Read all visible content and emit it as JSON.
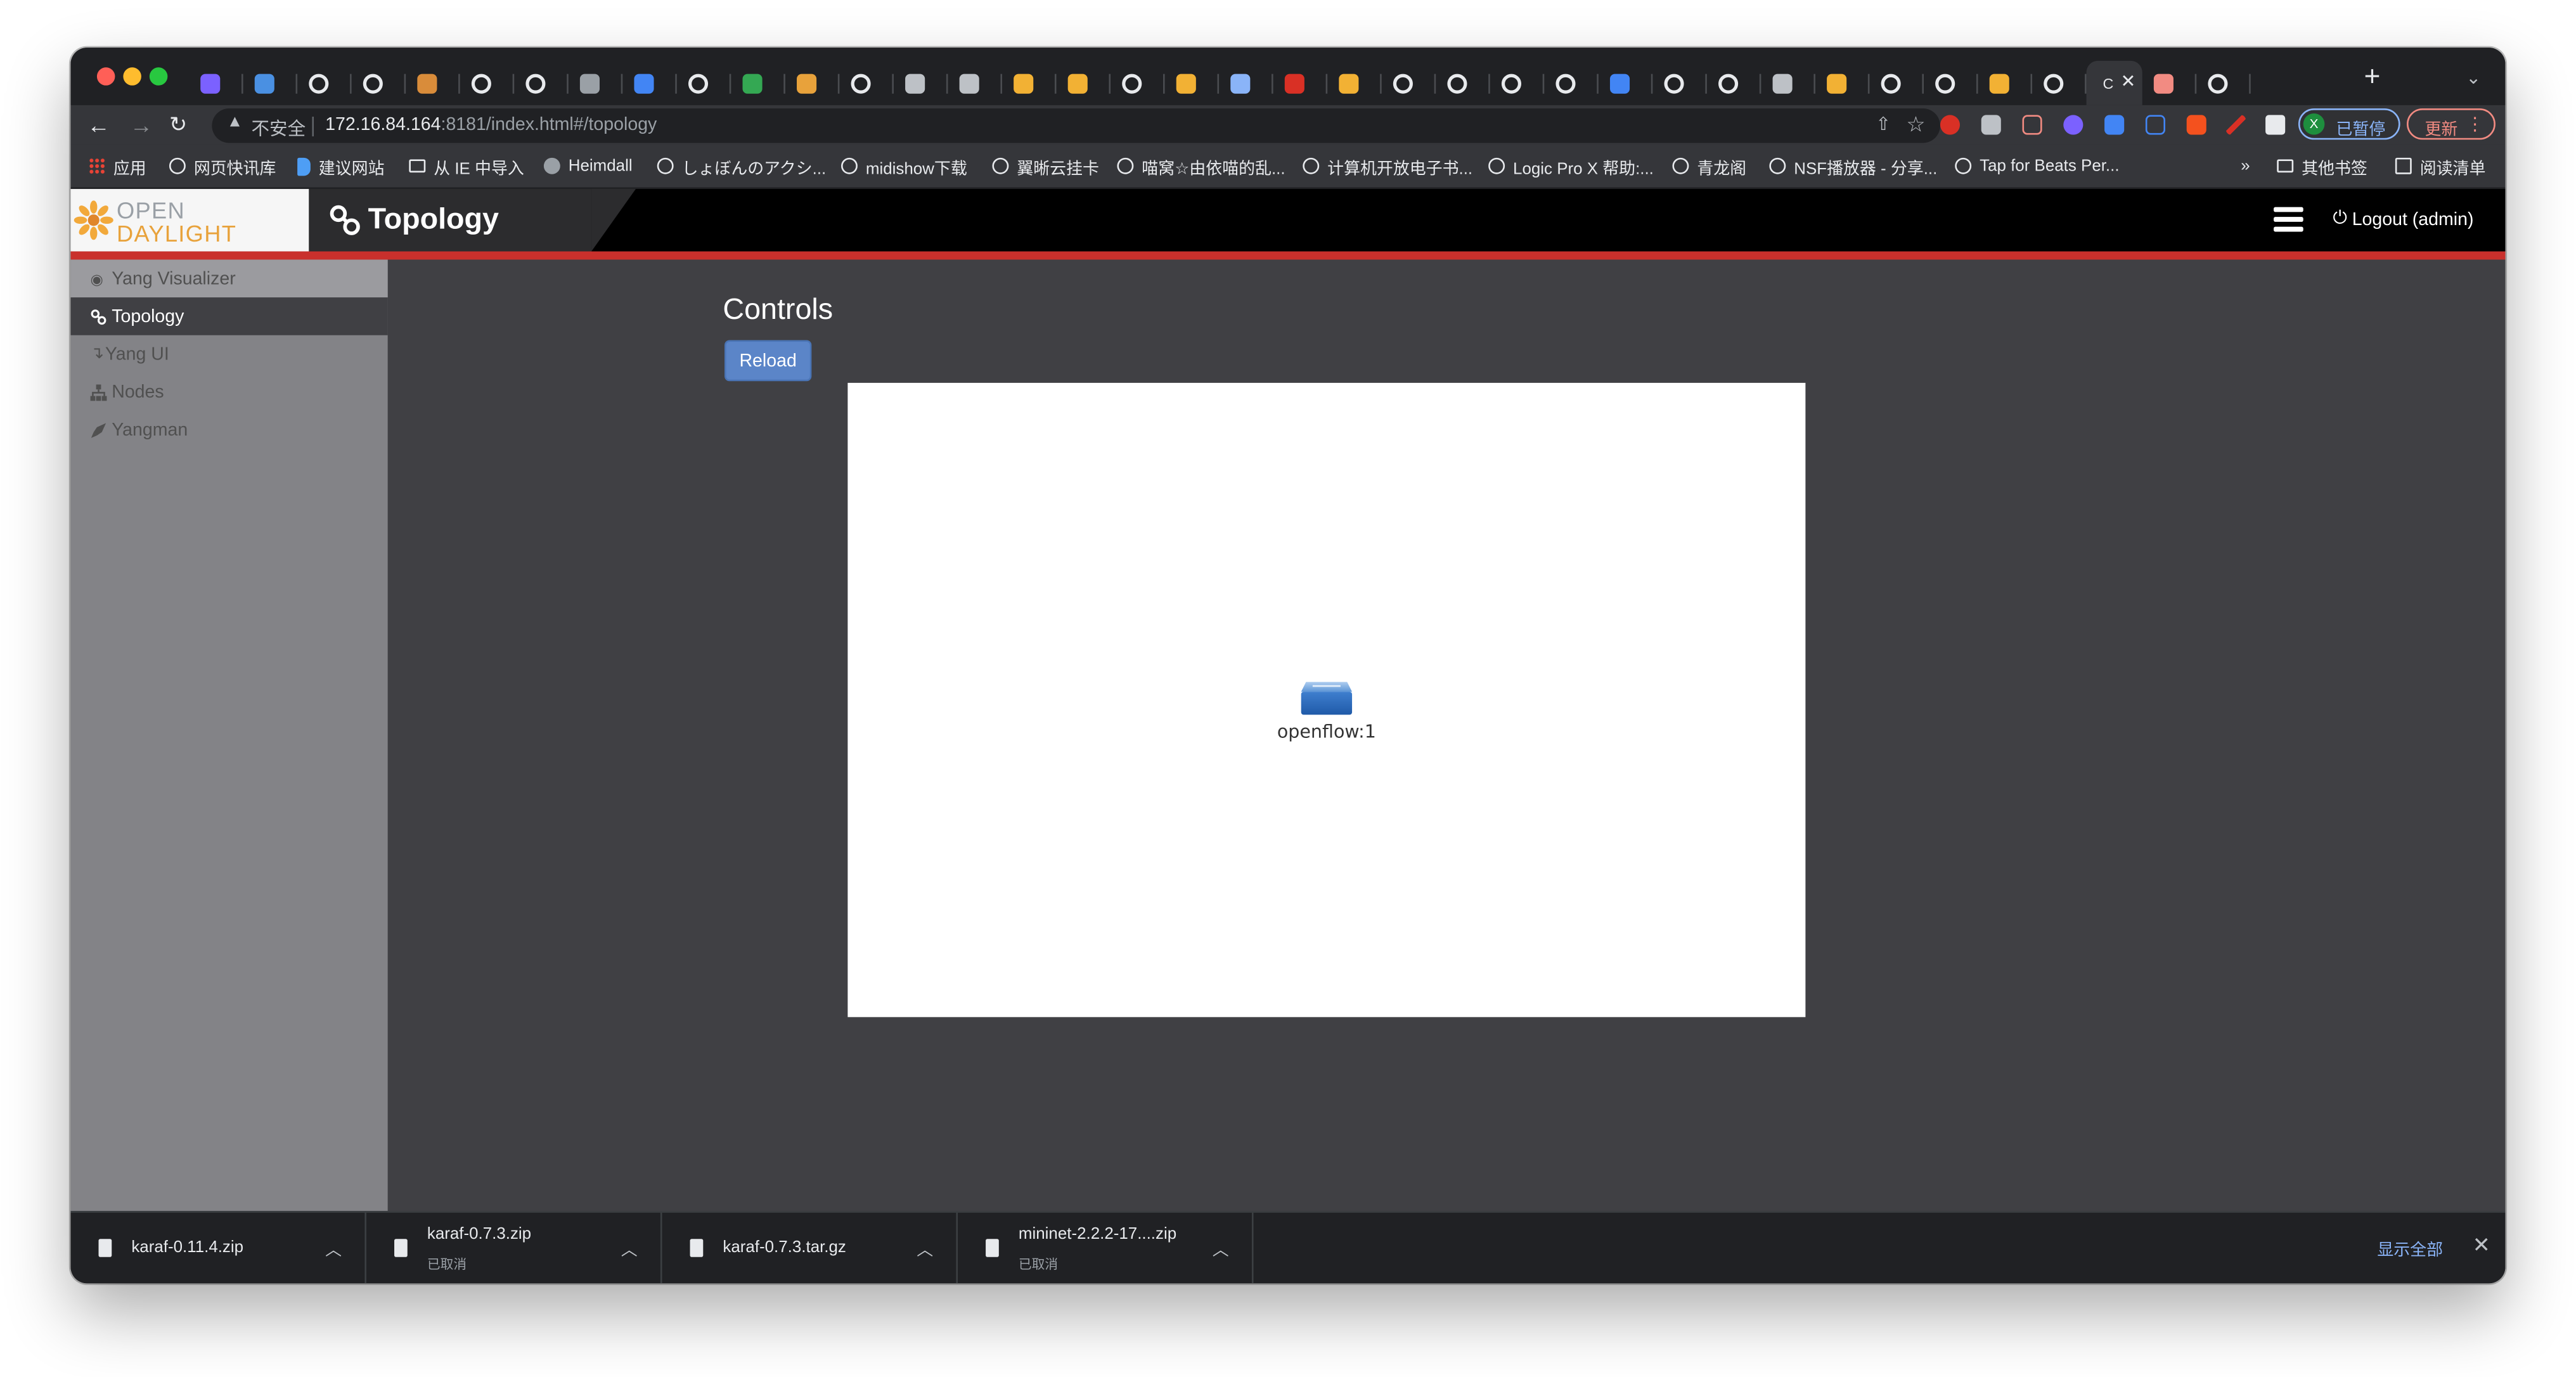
{
  "browser": {
    "active_tab_title": "C",
    "url_warning": "不安全",
    "url_host": "172.16.84.164",
    "url_rest": ":8181/index.html#/topology",
    "profile_label": "已暂停",
    "profile_initial": "X",
    "update_label": "更新",
    "new_tab_glyph": "+",
    "bookmarks": [
      "应用",
      "网页快讯库",
      "建议网站",
      "从 IE 中导入",
      "Heimdall",
      "しょぼんのアクシ...",
      "midishow下载",
      "翼晰云挂卡",
      "喵窝☆由依喵的乱...",
      "计算机开放电子书...",
      "Logic Pro X 帮助:...",
      "青龙阁",
      "NSF播放器 - 分享...",
      "Tap for Beats Per..."
    ],
    "bookmarks_overflow": "»",
    "other_bookmarks": "其他书签",
    "reading_list": "阅读清单"
  },
  "app": {
    "logo_line1": "OPEN",
    "logo_line2": "DAYLIGHT",
    "page_title": "Topology",
    "logout_label": "Logout (admin)",
    "sidebar": [
      {
        "label": "Yang Visualizer",
        "icon": "eye-icon"
      },
      {
        "label": "Topology",
        "icon": "link-icon"
      },
      {
        "label": "Yang UI",
        "icon": "level-down-icon"
      },
      {
        "label": "Nodes",
        "icon": "sitemap-icon"
      },
      {
        "label": "Yangman",
        "icon": "rocket-icon"
      }
    ],
    "controls_title": "Controls",
    "reload_label": "Reload",
    "node_label": "openflow:1"
  },
  "downloads": {
    "items": [
      {
        "name": "karaf-0.11.4.zip",
        "status": ""
      },
      {
        "name": "karaf-0.7.3.zip",
        "status": "已取消"
      },
      {
        "name": "karaf-0.7.3.tar.gz",
        "status": ""
      },
      {
        "name": "mininet-2.2.2-17....zip",
        "status": "已取消"
      }
    ],
    "show_all": "显示全部"
  },
  "colors": {
    "header_red_line": "#c9302c",
    "reload_button": "#5b85c8",
    "sidebar_bg": "#838387",
    "page_bg": "#404044"
  }
}
